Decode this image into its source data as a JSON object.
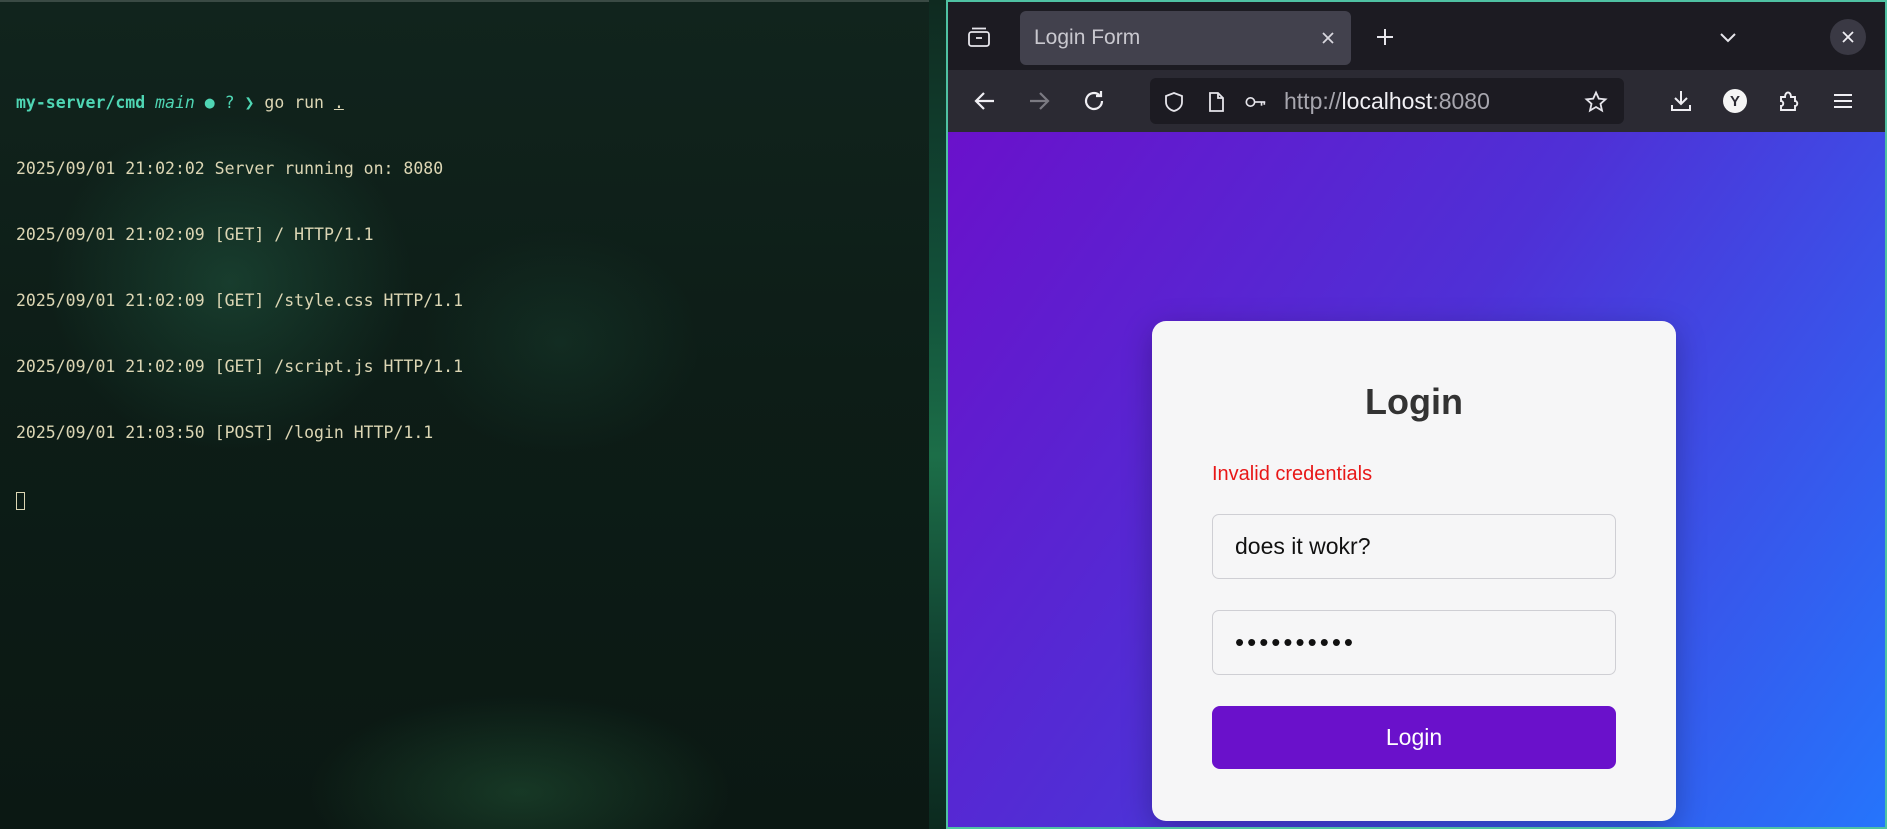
{
  "terminal": {
    "prompt": {
      "path": "my-server/cmd",
      "branch": "main",
      "dirty_marker": "●",
      "untracked_marker": "?",
      "arrow": "❯",
      "command": "go run",
      "argument": "."
    },
    "log_lines": [
      "2025/09/01 21:02:02 Server running on: 8080",
      "2025/09/01 21:02:09 [GET] / HTTP/1.1",
      "2025/09/01 21:02:09 [GET] /style.css HTTP/1.1",
      "2025/09/01 21:02:09 [GET] /script.js HTTP/1.1",
      "2025/09/01 21:03:50 [POST] /login HTTP/1.1"
    ]
  },
  "browser": {
    "tab": {
      "title": "Login Form"
    },
    "url": {
      "protocol": "http://",
      "host": "localhost",
      "port": ":8080"
    },
    "yandex_badge": "Y"
  },
  "page": {
    "title": "Login",
    "error": "Invalid credentials",
    "username_value": "does it wokr?",
    "password_value": "••••••••••",
    "login_button": "Login"
  },
  "colors": {
    "accent_purple": "#6a11cb",
    "accent_blue": "#2575fc",
    "error_red": "#e81717",
    "terminal_prompt": "#4fd6b4"
  }
}
